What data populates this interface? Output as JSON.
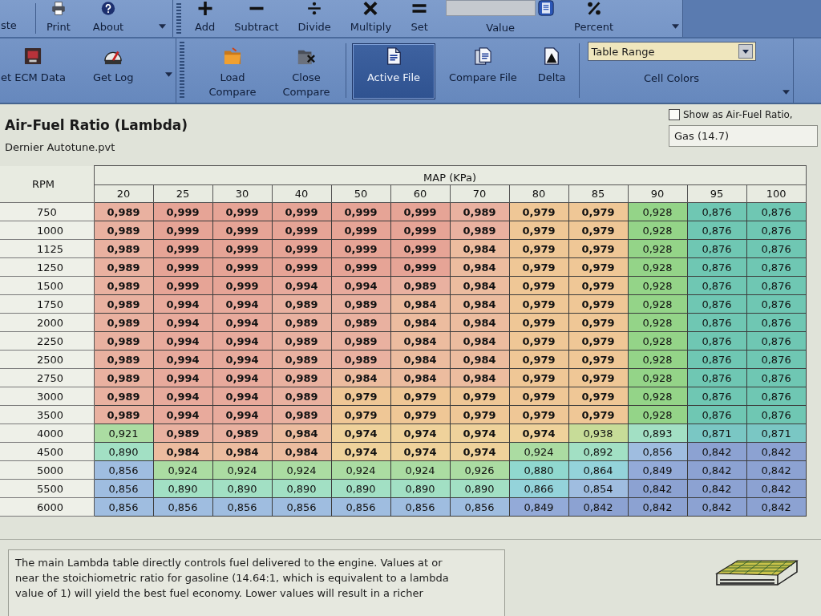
{
  "ribbon": {
    "top": {
      "file_group": {
        "buttons": [
          {
            "label": "ste"
          },
          {
            "label": "Print"
          },
          {
            "label": "About"
          }
        ],
        "launcher": true
      },
      "math_group": {
        "buttons": [
          {
            "label": "Add"
          },
          {
            "label": "Subtract"
          },
          {
            "label": "Divide"
          },
          {
            "label": "Multiply"
          },
          {
            "label": "Set"
          }
        ],
        "value_field": {
          "label": "Value"
        },
        "percent": {
          "label": "Percent"
        },
        "launcher": true
      }
    },
    "bottom": {
      "log_group": {
        "buttons": [
          {
            "label": "et ECM Data"
          },
          {
            "label": "Get Log"
          }
        ],
        "launcher": true
      },
      "compare_group": {
        "buttons": [
          {
            "label": "Load Compare"
          },
          {
            "label": "Close Compare"
          }
        ],
        "view_modes": [
          {
            "label": "Active File",
            "selected": true
          },
          {
            "label": "Compare File",
            "selected": false
          },
          {
            "label": "Delta",
            "selected": false
          }
        ],
        "cell_colors": {
          "value": "Table Range",
          "label": "Cell Colors"
        },
        "launcher": true
      }
    }
  },
  "panel": {
    "title": "Air-Fuel Ratio (Lambda)",
    "file": "Dernier Autotune.pvt",
    "show_afr": {
      "label": "Show as Air-Fuel Ratio,",
      "checked": false
    },
    "fuel": {
      "value": "Gas (14.7)"
    }
  },
  "table": {
    "row_axis": "RPM",
    "column_axis": "MAP (KPa)",
    "columns": [
      "20",
      "25",
      "30",
      "40",
      "50",
      "60",
      "70",
      "80",
      "85",
      "90",
      "95",
      "100"
    ],
    "rows": [
      {
        "rpm": "750",
        "cells": [
          {
            "value": "0,989",
            "emphasized": true,
            "color": "#e9b1a0"
          },
          {
            "value": "0,999",
            "emphasized": true,
            "color": "#e6a496"
          },
          {
            "value": "0,999",
            "emphasized": true,
            "color": "#e6a496"
          },
          {
            "value": "0,999",
            "emphasized": true,
            "color": "#e6a496"
          },
          {
            "value": "0,999",
            "emphasized": true,
            "color": "#e6a496"
          },
          {
            "value": "0,999",
            "emphasized": true,
            "color": "#e6a496"
          },
          {
            "value": "0,989",
            "emphasized": true,
            "color": "#e9b1a0"
          },
          {
            "value": "0,979",
            "emphasized": true,
            "color": "#efc796"
          },
          {
            "value": "0,979",
            "emphasized": true,
            "color": "#efc796"
          },
          {
            "value": "0,928",
            "emphasized": false,
            "color": "#94d488"
          },
          {
            "value": "0,876",
            "emphasized": false,
            "color": "#6fc7b3"
          },
          {
            "value": "0,876",
            "emphasized": false,
            "color": "#6fc7b3"
          }
        ]
      },
      {
        "rpm": "1000",
        "cells": [
          {
            "value": "0,989",
            "emphasized": true,
            "color": "#e9b1a0"
          },
          {
            "value": "0,999",
            "emphasized": true,
            "color": "#e6a496"
          },
          {
            "value": "0,999",
            "emphasized": true,
            "color": "#e6a496"
          },
          {
            "value": "0,999",
            "emphasized": true,
            "color": "#e6a496"
          },
          {
            "value": "0,999",
            "emphasized": true,
            "color": "#e6a496"
          },
          {
            "value": "0,999",
            "emphasized": true,
            "color": "#e6a496"
          },
          {
            "value": "0,989",
            "emphasized": true,
            "color": "#e9b1a0"
          },
          {
            "value": "0,979",
            "emphasized": true,
            "color": "#efc796"
          },
          {
            "value": "0,979",
            "emphasized": true,
            "color": "#efc796"
          },
          {
            "value": "0,928",
            "emphasized": false,
            "color": "#94d488"
          },
          {
            "value": "0,876",
            "emphasized": false,
            "color": "#6fc7b3"
          },
          {
            "value": "0,876",
            "emphasized": false,
            "color": "#6fc7b3"
          }
        ]
      },
      {
        "rpm": "1125",
        "cells": [
          {
            "value": "0,989",
            "emphasized": true,
            "color": "#e9b1a0"
          },
          {
            "value": "0,999",
            "emphasized": true,
            "color": "#e6a496"
          },
          {
            "value": "0,999",
            "emphasized": true,
            "color": "#e6a496"
          },
          {
            "value": "0,999",
            "emphasized": true,
            "color": "#e6a496"
          },
          {
            "value": "0,999",
            "emphasized": true,
            "color": "#e6a496"
          },
          {
            "value": "0,999",
            "emphasized": true,
            "color": "#e6a496"
          },
          {
            "value": "0,984",
            "emphasized": true,
            "color": "#ecbc9f"
          },
          {
            "value": "0,979",
            "emphasized": true,
            "color": "#efc796"
          },
          {
            "value": "0,979",
            "emphasized": true,
            "color": "#efc796"
          },
          {
            "value": "0,928",
            "emphasized": false,
            "color": "#94d488"
          },
          {
            "value": "0,876",
            "emphasized": false,
            "color": "#6fc7b3"
          },
          {
            "value": "0,876",
            "emphasized": false,
            "color": "#6fc7b3"
          }
        ]
      },
      {
        "rpm": "1250",
        "cells": [
          {
            "value": "0,989",
            "emphasized": true,
            "color": "#e9b1a0"
          },
          {
            "value": "0,999",
            "emphasized": true,
            "color": "#e6a496"
          },
          {
            "value": "0,999",
            "emphasized": true,
            "color": "#e6a496"
          },
          {
            "value": "0,999",
            "emphasized": true,
            "color": "#e6a496"
          },
          {
            "value": "0,999",
            "emphasized": true,
            "color": "#e6a496"
          },
          {
            "value": "0,999",
            "emphasized": true,
            "color": "#e6a496"
          },
          {
            "value": "0,984",
            "emphasized": true,
            "color": "#ecbc9f"
          },
          {
            "value": "0,979",
            "emphasized": true,
            "color": "#efc796"
          },
          {
            "value": "0,979",
            "emphasized": true,
            "color": "#efc796"
          },
          {
            "value": "0,928",
            "emphasized": false,
            "color": "#94d488"
          },
          {
            "value": "0,876",
            "emphasized": false,
            "color": "#6fc7b3"
          },
          {
            "value": "0,876",
            "emphasized": false,
            "color": "#6fc7b3"
          }
        ]
      },
      {
        "rpm": "1500",
        "cells": [
          {
            "value": "0,989",
            "emphasized": true,
            "color": "#e9b1a0"
          },
          {
            "value": "0,999",
            "emphasized": true,
            "color": "#e6a496"
          },
          {
            "value": "0,999",
            "emphasized": true,
            "color": "#e6a496"
          },
          {
            "value": "0,994",
            "emphasized": true,
            "color": "#e8aa9c"
          },
          {
            "value": "0,994",
            "emphasized": true,
            "color": "#e8aa9c"
          },
          {
            "value": "0,989",
            "emphasized": true,
            "color": "#e9b1a0"
          },
          {
            "value": "0,984",
            "emphasized": true,
            "color": "#ecbc9f"
          },
          {
            "value": "0,979",
            "emphasized": true,
            "color": "#efc796"
          },
          {
            "value": "0,979",
            "emphasized": true,
            "color": "#efc796"
          },
          {
            "value": "0,928",
            "emphasized": false,
            "color": "#94d488"
          },
          {
            "value": "0,876",
            "emphasized": false,
            "color": "#6fc7b3"
          },
          {
            "value": "0,876",
            "emphasized": false,
            "color": "#6fc7b3"
          }
        ]
      },
      {
        "rpm": "1750",
        "cells": [
          {
            "value": "0,989",
            "emphasized": true,
            "color": "#e9b1a0"
          },
          {
            "value": "0,994",
            "emphasized": true,
            "color": "#e8aa9c"
          },
          {
            "value": "0,994",
            "emphasized": true,
            "color": "#e8aa9c"
          },
          {
            "value": "0,989",
            "emphasized": true,
            "color": "#e9b1a0"
          },
          {
            "value": "0,989",
            "emphasized": true,
            "color": "#e9b1a0"
          },
          {
            "value": "0,984",
            "emphasized": true,
            "color": "#ecbc9f"
          },
          {
            "value": "0,984",
            "emphasized": true,
            "color": "#ecbc9f"
          },
          {
            "value": "0,979",
            "emphasized": true,
            "color": "#efc796"
          },
          {
            "value": "0,979",
            "emphasized": true,
            "color": "#efc796"
          },
          {
            "value": "0,928",
            "emphasized": false,
            "color": "#94d488"
          },
          {
            "value": "0,876",
            "emphasized": false,
            "color": "#6fc7b3"
          },
          {
            "value": "0,876",
            "emphasized": false,
            "color": "#6fc7b3"
          }
        ]
      },
      {
        "rpm": "2000",
        "cells": [
          {
            "value": "0,989",
            "emphasized": true,
            "color": "#e9b1a0"
          },
          {
            "value": "0,994",
            "emphasized": true,
            "color": "#e8aa9c"
          },
          {
            "value": "0,994",
            "emphasized": true,
            "color": "#e8aa9c"
          },
          {
            "value": "0,989",
            "emphasized": true,
            "color": "#e9b1a0"
          },
          {
            "value": "0,989",
            "emphasized": true,
            "color": "#e9b1a0"
          },
          {
            "value": "0,984",
            "emphasized": true,
            "color": "#ecbc9f"
          },
          {
            "value": "0,984",
            "emphasized": true,
            "color": "#ecbc9f"
          },
          {
            "value": "0,979",
            "emphasized": true,
            "color": "#efc796"
          },
          {
            "value": "0,979",
            "emphasized": true,
            "color": "#efc796"
          },
          {
            "value": "0,928",
            "emphasized": false,
            "color": "#94d488"
          },
          {
            "value": "0,876",
            "emphasized": false,
            "color": "#6fc7b3"
          },
          {
            "value": "0,876",
            "emphasized": false,
            "color": "#6fc7b3"
          }
        ]
      },
      {
        "rpm": "2250",
        "cells": [
          {
            "value": "0,989",
            "emphasized": true,
            "color": "#e9b1a0"
          },
          {
            "value": "0,994",
            "emphasized": true,
            "color": "#e8aa9c"
          },
          {
            "value": "0,994",
            "emphasized": true,
            "color": "#e8aa9c"
          },
          {
            "value": "0,989",
            "emphasized": true,
            "color": "#e9b1a0"
          },
          {
            "value": "0,989",
            "emphasized": true,
            "color": "#e9b1a0"
          },
          {
            "value": "0,984",
            "emphasized": true,
            "color": "#ecbc9f"
          },
          {
            "value": "0,984",
            "emphasized": true,
            "color": "#ecbc9f"
          },
          {
            "value": "0,979",
            "emphasized": true,
            "color": "#efc796"
          },
          {
            "value": "0,979",
            "emphasized": true,
            "color": "#efc796"
          },
          {
            "value": "0,928",
            "emphasized": false,
            "color": "#94d488"
          },
          {
            "value": "0,876",
            "emphasized": false,
            "color": "#6fc7b3"
          },
          {
            "value": "0,876",
            "emphasized": false,
            "color": "#6fc7b3"
          }
        ]
      },
      {
        "rpm": "2500",
        "cells": [
          {
            "value": "0,989",
            "emphasized": true,
            "color": "#e9b1a0"
          },
          {
            "value": "0,994",
            "emphasized": true,
            "color": "#e8aa9c"
          },
          {
            "value": "0,994",
            "emphasized": true,
            "color": "#e8aa9c"
          },
          {
            "value": "0,989",
            "emphasized": true,
            "color": "#e9b1a0"
          },
          {
            "value": "0,989",
            "emphasized": true,
            "color": "#e9b1a0"
          },
          {
            "value": "0,984",
            "emphasized": true,
            "color": "#ecbc9f"
          },
          {
            "value": "0,984",
            "emphasized": true,
            "color": "#ecbc9f"
          },
          {
            "value": "0,979",
            "emphasized": true,
            "color": "#efc796"
          },
          {
            "value": "0,979",
            "emphasized": true,
            "color": "#efc796"
          },
          {
            "value": "0,928",
            "emphasized": false,
            "color": "#94d488"
          },
          {
            "value": "0,876",
            "emphasized": false,
            "color": "#6fc7b3"
          },
          {
            "value": "0,876",
            "emphasized": false,
            "color": "#6fc7b3"
          }
        ]
      },
      {
        "rpm": "2750",
        "cells": [
          {
            "value": "0,989",
            "emphasized": true,
            "color": "#e9b1a0"
          },
          {
            "value": "0,994",
            "emphasized": true,
            "color": "#e8aa9c"
          },
          {
            "value": "0,994",
            "emphasized": true,
            "color": "#e8aa9c"
          },
          {
            "value": "0,989",
            "emphasized": true,
            "color": "#e9b1a0"
          },
          {
            "value": "0,984",
            "emphasized": true,
            "color": "#ecbc9f"
          },
          {
            "value": "0,984",
            "emphasized": true,
            "color": "#ecbc9f"
          },
          {
            "value": "0,984",
            "emphasized": true,
            "color": "#ecbc9f"
          },
          {
            "value": "0,979",
            "emphasized": true,
            "color": "#efc796"
          },
          {
            "value": "0,979",
            "emphasized": true,
            "color": "#efc796"
          },
          {
            "value": "0,928",
            "emphasized": false,
            "color": "#94d488"
          },
          {
            "value": "0,876",
            "emphasized": false,
            "color": "#6fc7b3"
          },
          {
            "value": "0,876",
            "emphasized": false,
            "color": "#6fc7b3"
          }
        ]
      },
      {
        "rpm": "3000",
        "cells": [
          {
            "value": "0,989",
            "emphasized": true,
            "color": "#e9b1a0"
          },
          {
            "value": "0,994",
            "emphasized": true,
            "color": "#e8aa9c"
          },
          {
            "value": "0,994",
            "emphasized": true,
            "color": "#e8aa9c"
          },
          {
            "value": "0,989",
            "emphasized": true,
            "color": "#e9b1a0"
          },
          {
            "value": "0,979",
            "emphasized": true,
            "color": "#efc796"
          },
          {
            "value": "0,979",
            "emphasized": true,
            "color": "#efc796"
          },
          {
            "value": "0,979",
            "emphasized": true,
            "color": "#efc796"
          },
          {
            "value": "0,979",
            "emphasized": true,
            "color": "#efc796"
          },
          {
            "value": "0,979",
            "emphasized": true,
            "color": "#efc796"
          },
          {
            "value": "0,928",
            "emphasized": false,
            "color": "#94d488"
          },
          {
            "value": "0,876",
            "emphasized": false,
            "color": "#6fc7b3"
          },
          {
            "value": "0,876",
            "emphasized": false,
            "color": "#6fc7b3"
          }
        ]
      },
      {
        "rpm": "3500",
        "cells": [
          {
            "value": "0,989",
            "emphasized": true,
            "color": "#e9b1a0"
          },
          {
            "value": "0,994",
            "emphasized": true,
            "color": "#e8aa9c"
          },
          {
            "value": "0,994",
            "emphasized": true,
            "color": "#e8aa9c"
          },
          {
            "value": "0,989",
            "emphasized": true,
            "color": "#e9b1a0"
          },
          {
            "value": "0,979",
            "emphasized": true,
            "color": "#efc796"
          },
          {
            "value": "0,979",
            "emphasized": true,
            "color": "#efc796"
          },
          {
            "value": "0,979",
            "emphasized": true,
            "color": "#efc796"
          },
          {
            "value": "0,979",
            "emphasized": true,
            "color": "#efc796"
          },
          {
            "value": "0,979",
            "emphasized": true,
            "color": "#efc796"
          },
          {
            "value": "0,928",
            "emphasized": false,
            "color": "#94d488"
          },
          {
            "value": "0,876",
            "emphasized": false,
            "color": "#6fc7b3"
          },
          {
            "value": "0,876",
            "emphasized": false,
            "color": "#6fc7b3"
          }
        ]
      },
      {
        "rpm": "4000",
        "cells": [
          {
            "value": "0,921",
            "emphasized": false,
            "color": "#abdca2"
          },
          {
            "value": "0,989",
            "emphasized": true,
            "color": "#e9b1a0"
          },
          {
            "value": "0,989",
            "emphasized": true,
            "color": "#e9b1a0"
          },
          {
            "value": "0,984",
            "emphasized": true,
            "color": "#ecbc9f"
          },
          {
            "value": "0,974",
            "emphasized": true,
            "color": "#efd29b"
          },
          {
            "value": "0,974",
            "emphasized": true,
            "color": "#efd29b"
          },
          {
            "value": "0,974",
            "emphasized": true,
            "color": "#efd29b"
          },
          {
            "value": "0,974",
            "emphasized": true,
            "color": "#efd29b"
          },
          {
            "value": "0,938",
            "emphasized": false,
            "color": "#c7dc98"
          },
          {
            "value": "0,893",
            "emphasized": false,
            "color": "#a2e0c4"
          },
          {
            "value": "0,871",
            "emphasized": false,
            "color": "#7ac7c4"
          },
          {
            "value": "0,871",
            "emphasized": false,
            "color": "#7ac7c4"
          }
        ]
      },
      {
        "rpm": "4500",
        "cells": [
          {
            "value": "0,890",
            "emphasized": false,
            "color": "#a2e0c4"
          },
          {
            "value": "0,984",
            "emphasized": true,
            "color": "#ecbc9f"
          },
          {
            "value": "0,984",
            "emphasized": true,
            "color": "#ecbc9f"
          },
          {
            "value": "0,984",
            "emphasized": true,
            "color": "#ecbc9f"
          },
          {
            "value": "0,974",
            "emphasized": true,
            "color": "#efd29b"
          },
          {
            "value": "0,974",
            "emphasized": true,
            "color": "#efd29b"
          },
          {
            "value": "0,974",
            "emphasized": true,
            "color": "#efd29b"
          },
          {
            "value": "0,924",
            "emphasized": false,
            "color": "#abdca2"
          },
          {
            "value": "0,892",
            "emphasized": false,
            "color": "#a2e0c4"
          },
          {
            "value": "0,856",
            "emphasized": false,
            "color": "#9fbde0"
          },
          {
            "value": "0,842",
            "emphasized": false,
            "color": "#8ca2d2"
          },
          {
            "value": "0,842",
            "emphasized": false,
            "color": "#8ca2d2"
          }
        ]
      },
      {
        "rpm": "5000",
        "cells": [
          {
            "value": "0,856",
            "emphasized": false,
            "color": "#9fbde0"
          },
          {
            "value": "0,924",
            "emphasized": false,
            "color": "#abdca2"
          },
          {
            "value": "0,924",
            "emphasized": false,
            "color": "#abdca2"
          },
          {
            "value": "0,924",
            "emphasized": false,
            "color": "#abdca2"
          },
          {
            "value": "0,924",
            "emphasized": false,
            "color": "#abdca2"
          },
          {
            "value": "0,924",
            "emphasized": false,
            "color": "#abdca2"
          },
          {
            "value": "0,926",
            "emphasized": false,
            "color": "#abdca2"
          },
          {
            "value": "0,880",
            "emphasized": false,
            "color": "#90d8cf"
          },
          {
            "value": "0,864",
            "emphasized": false,
            "color": "#94d3da"
          },
          {
            "value": "0,849",
            "emphasized": false,
            "color": "#93aad8"
          },
          {
            "value": "0,842",
            "emphasized": false,
            "color": "#8ca2d2"
          },
          {
            "value": "0,842",
            "emphasized": false,
            "color": "#8ca2d2"
          }
        ]
      },
      {
        "rpm": "5500",
        "cells": [
          {
            "value": "0,856",
            "emphasized": false,
            "color": "#9fbde0"
          },
          {
            "value": "0,890",
            "emphasized": false,
            "color": "#a2e0c4"
          },
          {
            "value": "0,890",
            "emphasized": false,
            "color": "#a2e0c4"
          },
          {
            "value": "0,890",
            "emphasized": false,
            "color": "#a2e0c4"
          },
          {
            "value": "0,890",
            "emphasized": false,
            "color": "#a2e0c4"
          },
          {
            "value": "0,890",
            "emphasized": false,
            "color": "#a2e0c4"
          },
          {
            "value": "0,890",
            "emphasized": false,
            "color": "#a2e0c4"
          },
          {
            "value": "0,866",
            "emphasized": false,
            "color": "#94d3da"
          },
          {
            "value": "0,854",
            "emphasized": false,
            "color": "#9fbde0"
          },
          {
            "value": "0,842",
            "emphasized": false,
            "color": "#8ca2d2"
          },
          {
            "value": "0,842",
            "emphasized": false,
            "color": "#8ca2d2"
          },
          {
            "value": "0,842",
            "emphasized": false,
            "color": "#8ca2d2"
          }
        ]
      },
      {
        "rpm": "6000",
        "cells": [
          {
            "value": "0,856",
            "emphasized": false,
            "color": "#9fbde0"
          },
          {
            "value": "0,856",
            "emphasized": false,
            "color": "#9fbde0"
          },
          {
            "value": "0,856",
            "emphasized": false,
            "color": "#9fbde0"
          },
          {
            "value": "0,856",
            "emphasized": false,
            "color": "#9fbde0"
          },
          {
            "value": "0,856",
            "emphasized": false,
            "color": "#9fbde0"
          },
          {
            "value": "0,856",
            "emphasized": false,
            "color": "#9fbde0"
          },
          {
            "value": "0,856",
            "emphasized": false,
            "color": "#9fbde0"
          },
          {
            "value": "0,849",
            "emphasized": false,
            "color": "#93aad8"
          },
          {
            "value": "0,842",
            "emphasized": false,
            "color": "#8ca2d2"
          },
          {
            "value": "0,842",
            "emphasized": false,
            "color": "#8ca2d2"
          },
          {
            "value": "0,842",
            "emphasized": false,
            "color": "#8ca2d2"
          },
          {
            "value": "0,842",
            "emphasized": false,
            "color": "#8ca2d2"
          }
        ]
      }
    ]
  },
  "description": "The main Lambda table directly controls fuel delivered to the engine. Values at or near the stoichiometric ratio for gasoline (14.64:1, which is equivalent to a lambda value of 1) will yield the best fuel economy. Lower values will result in a richer"
}
